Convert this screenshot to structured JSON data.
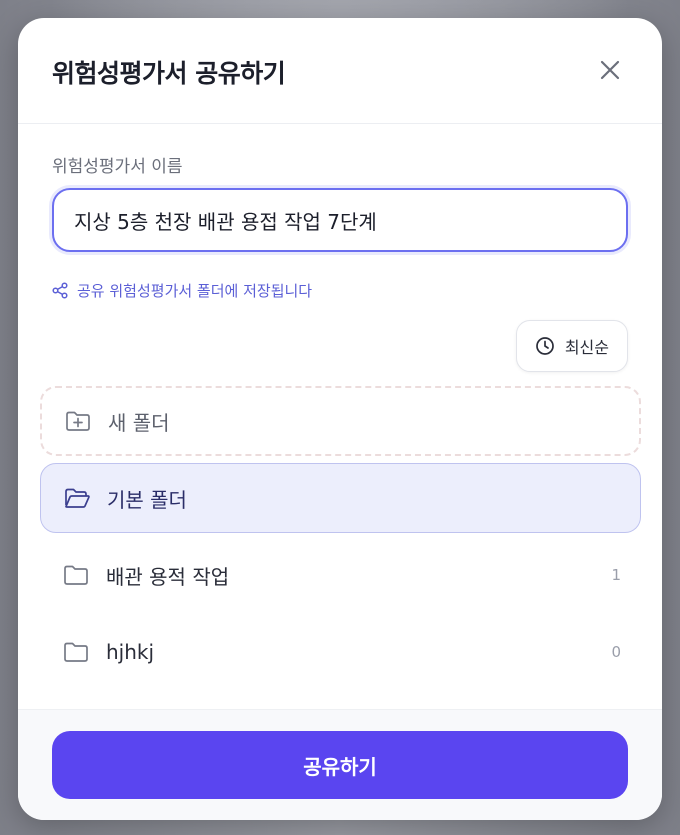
{
  "dialog": {
    "title": "위험성평가서 공유하기"
  },
  "name_field": {
    "label": "위험성평가서 이름",
    "value": "지상 5층 천장 배관 용접 작업 7단계"
  },
  "hint": {
    "text": "공유 위험성평가서 폴더에 저장됩니다"
  },
  "sort": {
    "label": "최신순"
  },
  "new_folder": {
    "label": "새 폴더"
  },
  "folders": [
    {
      "name": "기본 폴더",
      "count": ""
    },
    {
      "name": "배관 용적 작업",
      "count": "1"
    },
    {
      "name": "hjhkj",
      "count": "0"
    }
  ],
  "share_button": {
    "label": "공유하기"
  },
  "colors": {
    "accent": "#5a45f0",
    "selected_bg": "#eceefc",
    "hint": "#5b5fd6"
  },
  "icons": {
    "close": "close-icon",
    "share": "share-nodes-icon",
    "clock": "clock-icon",
    "folder_plus": "folder-plus-icon",
    "folder_open": "folder-open-icon",
    "folder": "folder-icon"
  }
}
